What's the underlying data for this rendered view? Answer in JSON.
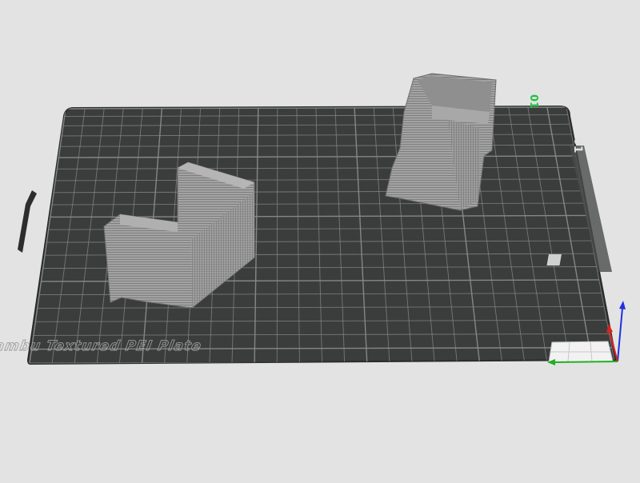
{
  "viewport": {
    "plate_label": "Bambu Textured PEI Plate",
    "plate_number": "01",
    "corner_label": "01",
    "colors": {
      "background": "#e3e3e3",
      "plate": "#3b3d3c",
      "grid": "#8a8c8b",
      "model": "#9a9a9a",
      "axis_x": "#e02020",
      "axis_y": "#20b020",
      "axis_z": "#2030e0",
      "label_accent": "#20c040"
    }
  }
}
